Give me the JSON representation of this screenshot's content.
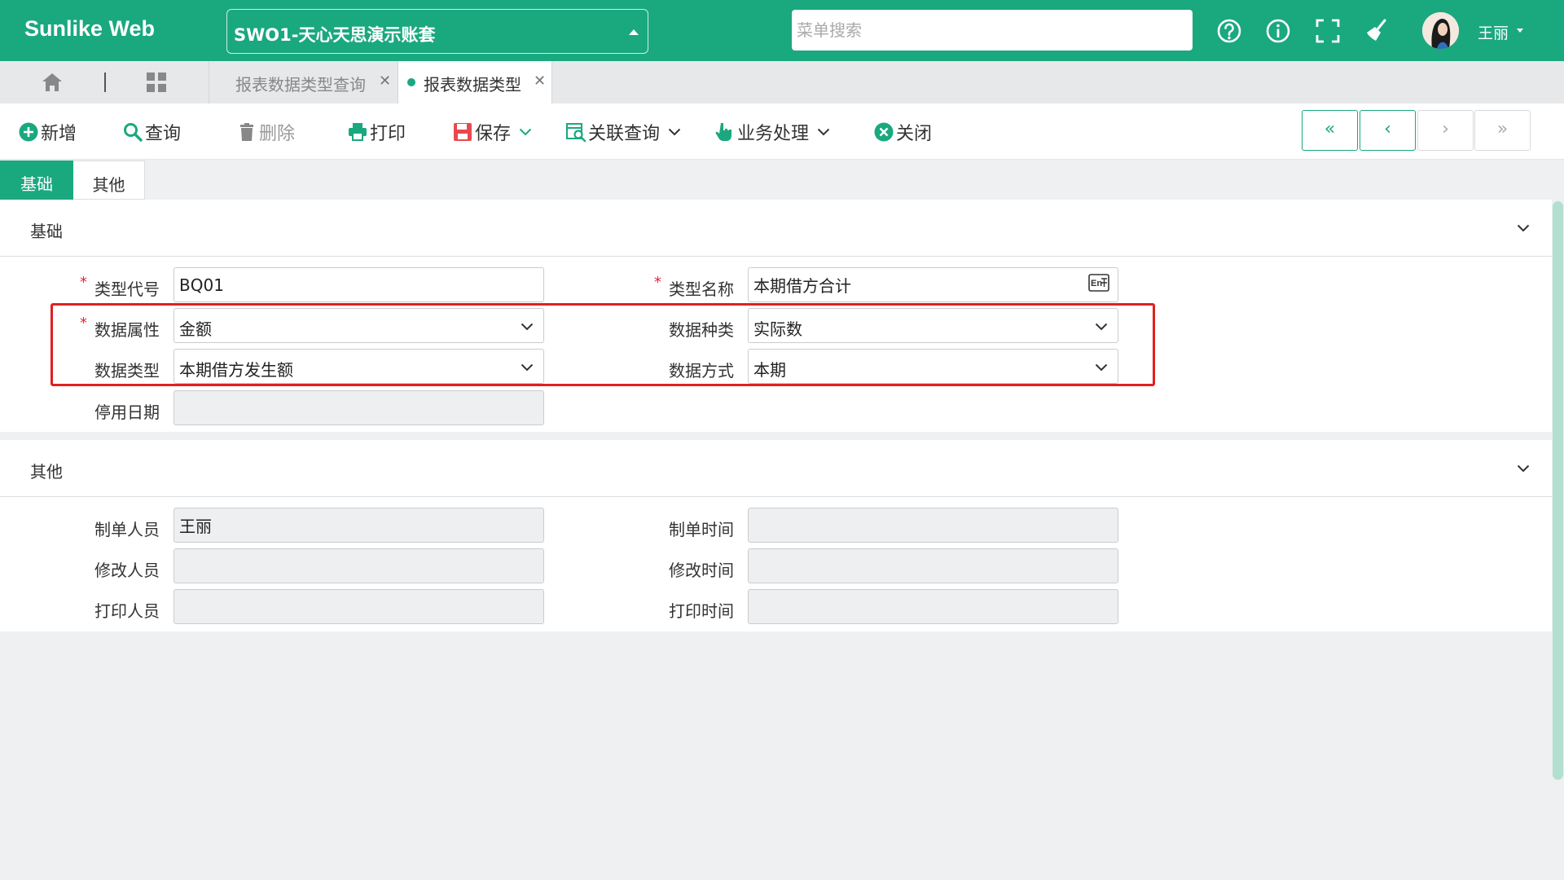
{
  "app": {
    "brand": "Sunlike Web",
    "account": "SWO1-天心天思演示账套",
    "search_placeholder": "菜单搜索",
    "user_name": "王丽",
    "icons": [
      "help-icon",
      "info-icon",
      "fullscreen-icon",
      "broom-icon",
      "avatar"
    ]
  },
  "tabs": [
    {
      "label": "报表数据类型查询",
      "active": false
    },
    {
      "label": "报表数据类型",
      "active": true
    }
  ],
  "toolbar": {
    "add": "新增",
    "query": "查询",
    "delete": "删除",
    "print": "打印",
    "save": "保存",
    "related_query": "关联查询",
    "business": "业务处理",
    "close": "关闭",
    "nav": [
      "«",
      "‹",
      "›",
      "»"
    ]
  },
  "section_tabs": [
    "基础",
    "其他"
  ],
  "basic": {
    "title": "基础",
    "type_code_label": "类型代号",
    "type_code": "BQ01",
    "type_name_label": "类型名称",
    "type_name": "本期借方合计",
    "data_attr_label": "数据属性",
    "data_attr": "金额",
    "data_kind_label": "数据种类",
    "data_kind": "实际数",
    "data_type_label": "数据类型",
    "data_type": "本期借方发生额",
    "data_mode_label": "数据方式",
    "data_mode": "本期",
    "stop_date_label": "停用日期",
    "stop_date": ""
  },
  "other": {
    "title": "其他",
    "creator_label": "制单人员",
    "creator": "王丽",
    "create_time_label": "制单时间",
    "create_time": "",
    "modifier_label": "修改人员",
    "modifier": "",
    "modify_time_label": "修改时间",
    "modify_time": "",
    "printer_label": "打印人员",
    "printer": "",
    "print_time_label": "打印时间",
    "print_time": ""
  },
  "colors": {
    "primary": "#1aa87f",
    "required": "#ee2233",
    "highlight": "#e02020"
  }
}
